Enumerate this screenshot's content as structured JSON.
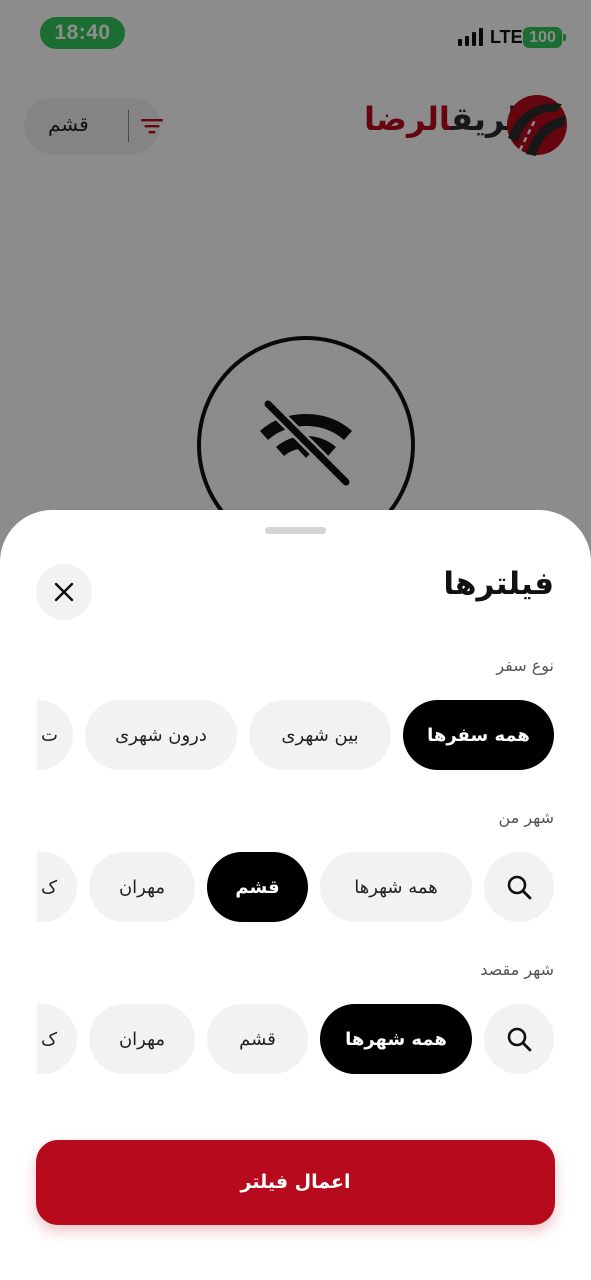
{
  "status_bar": {
    "time": "18:40",
    "network": "LTE",
    "battery": "100",
    "accent": "#34c759"
  },
  "header": {
    "brand_part1": "طریق",
    "brand_part2": "الرضا",
    "brand_red": "#b70a1c",
    "city_filter_label": "قشم"
  },
  "filters_sheet": {
    "title": "فیلترها",
    "trip_type": {
      "label": "نوع سفر",
      "chips": [
        {
          "label": "همه سفرها",
          "selected": true
        },
        {
          "label": "بین شهری",
          "selected": false
        },
        {
          "label": "درون شهری",
          "selected": false
        },
        {
          "label": "ت",
          "selected": false
        }
      ]
    },
    "origin_city": {
      "label": "شهر من",
      "chips": [
        {
          "label": "همه شهرها",
          "selected": false
        },
        {
          "label": "قشم",
          "selected": true
        },
        {
          "label": "مهران",
          "selected": false
        },
        {
          "label": "ک",
          "selected": false
        }
      ]
    },
    "destination_city": {
      "label": "شهر مقصد",
      "chips": [
        {
          "label": "همه شهرها",
          "selected": true
        },
        {
          "label": "قشم",
          "selected": false
        },
        {
          "label": "مهران",
          "selected": false
        },
        {
          "label": "ک",
          "selected": false
        }
      ]
    },
    "apply_label": "اعمال فیلتر"
  }
}
